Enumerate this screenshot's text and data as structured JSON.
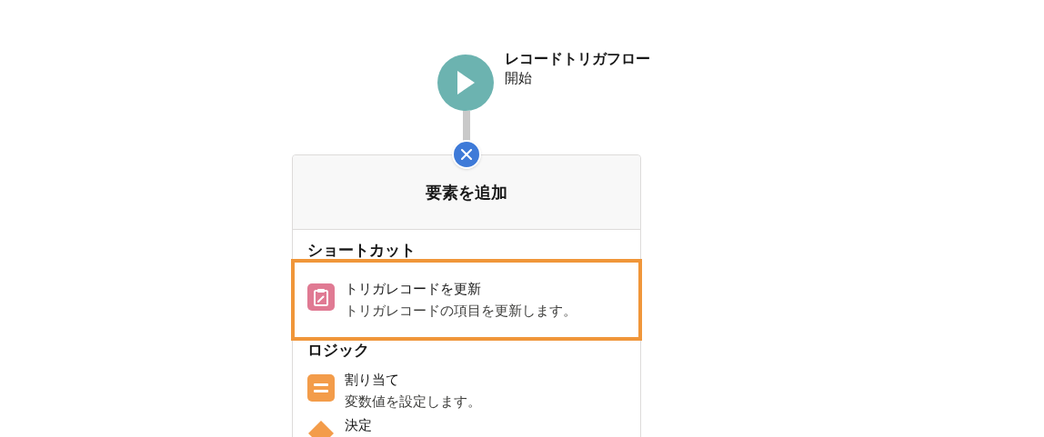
{
  "start_node": {
    "title": "レコードトリガフロー",
    "subtitle": "開始"
  },
  "panel": {
    "title": "要素を追加",
    "sections": [
      {
        "heading": "ショートカット",
        "items": [
          {
            "kind": "record-update",
            "title": "トリガレコードを更新",
            "description": "トリガレコードの項目を更新します。",
            "highlighted": true
          }
        ]
      },
      {
        "heading": "ロジック",
        "items": [
          {
            "kind": "assignment",
            "title": "割り当て",
            "description": "変数値を設定します。",
            "highlighted": false
          },
          {
            "kind": "decision",
            "title": "決定",
            "highlighted": false
          }
        ]
      }
    ]
  }
}
